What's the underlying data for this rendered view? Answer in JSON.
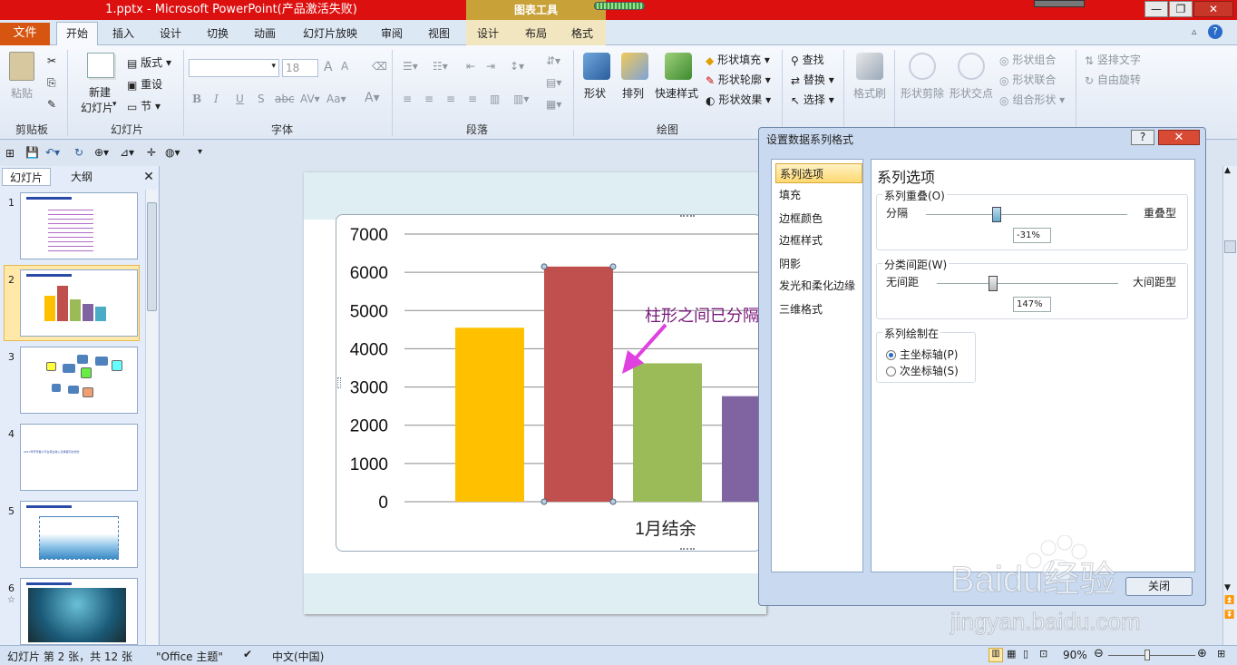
{
  "title_bar": {
    "title": "1.pptx - Microsoft PowerPoint(产品激活失败)",
    "context_tools": "图表工具",
    "buttons": [
      "—",
      "❐",
      "✕"
    ]
  },
  "tabs": {
    "file": "文件",
    "items": [
      "开始",
      "插入",
      "设计",
      "切换",
      "动画",
      "幻灯片放映",
      "审阅",
      "视图",
      "设计",
      "布局",
      "格式"
    ]
  },
  "ribbon": {
    "clipboard": {
      "paste": "粘贴",
      "label": "剪贴板"
    },
    "slides": {
      "new_slide": "新建",
      "new_slide2": "幻灯片",
      "layout": "版式",
      "reset": "重设",
      "section": "节",
      "label": "幻灯片"
    },
    "font": {
      "font_size": "18",
      "label": "字体",
      "bold": "B",
      "italic": "I",
      "underline": "U",
      "shadow": "S",
      "strike": "abc"
    },
    "paragraph": {
      "label": "段落"
    },
    "drawing": {
      "shapes": "形状",
      "arrange": "排列",
      "quick_styles": "快速样式",
      "fill": "形状填充",
      "outline": "形状轮廓",
      "effects": "形状效果",
      "label": "绘图"
    },
    "editing": {
      "find": "查找",
      "replace": "替换",
      "select": "选择"
    },
    "format_painter": "格式刷",
    "shape_ops": {
      "cut": "形状剪除",
      "intersect": "形状交点",
      "combine": "形状组合",
      "union": "形状联合",
      "group": "组合形状"
    },
    "text": {
      "vertical": "竖排文字",
      "rotate": "自由旋转"
    }
  },
  "left_panel": {
    "tab_slides": "幻灯片",
    "tab_outline": "大纲",
    "slide_numbers": [
      "1",
      "2",
      "3",
      "4",
      "5",
      "6"
    ],
    "slide4_text": "2017年开年各大平台营业收入及季度同比增长"
  },
  "chart_data": {
    "type": "bar",
    "categories": [
      "1月结余"
    ],
    "series": [
      {
        "values": [
          4550
        ],
        "color": "#ffc000"
      },
      {
        "values": [
          6150
        ],
        "color": "#c0504d"
      },
      {
        "values": [
          3620
        ],
        "color": "#9bbb59"
      },
      {
        "values": [
          2760
        ],
        "color": "#8064a2"
      }
    ],
    "ylim": [
      0,
      7000
    ],
    "yticks": [
      "0",
      "1000",
      "2000",
      "3000",
      "4000",
      "5000",
      "6000",
      "7000"
    ],
    "xlabel": "1月结余",
    "grid": true
  },
  "annotation": "柱形之间已分隔开",
  "dialog": {
    "title": "设置数据系列格式",
    "help": "?",
    "close": "✕",
    "nav": [
      "系列选项",
      "填充",
      "边框颜色",
      "边框样式",
      "阴影",
      "发光和柔化边缘",
      "三维格式"
    ],
    "heading": "系列选项",
    "overlap": {
      "label": "系列重叠(O)",
      "left": "分隔",
      "right": "重叠型",
      "value": "-31%",
      "fraction": 0.35
    },
    "gap": {
      "label": "分类间距(W)",
      "left": "无间距",
      "right": "大间距型",
      "value": "147%",
      "fraction": 0.31
    },
    "plot_on": {
      "label": "系列绘制在",
      "primary": "主坐标轴(P)",
      "secondary": "次坐标轴(S)"
    },
    "close_button": "关闭"
  },
  "status_bar": {
    "slide_info": "幻灯片 第 2 张，共 12 张",
    "theme": "\"Office 主题\"",
    "language": "中文(中国)",
    "zoom": "90%"
  },
  "watermark": {
    "brand": "Baidu经验",
    "url": "jingyan.baidu.com"
  }
}
